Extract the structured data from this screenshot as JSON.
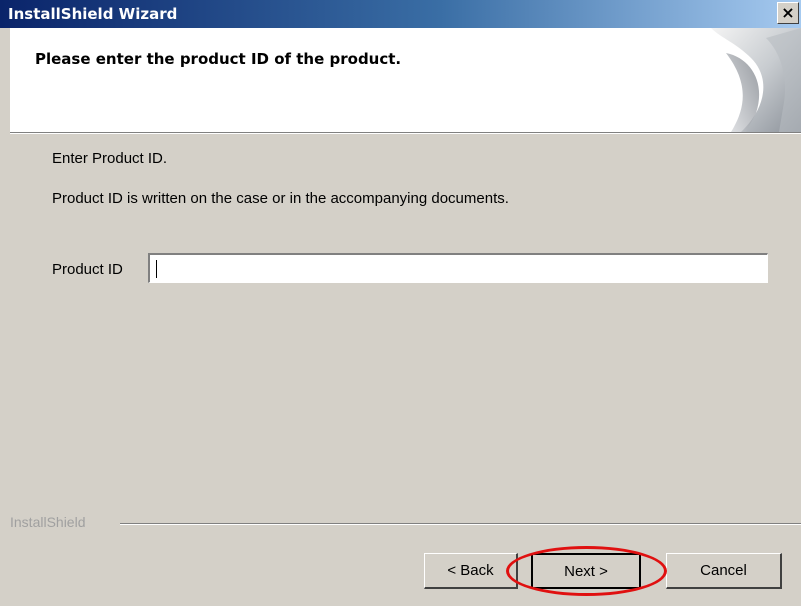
{
  "window": {
    "title": "InstallShield Wizard",
    "close_glyph": "×"
  },
  "header": {
    "title": "Please enter the product ID of the product."
  },
  "body": {
    "instruction": "Enter Product ID.",
    "description": "Product ID is written on the case or in the accompanying documents.",
    "field_label": "Product ID",
    "field_value": ""
  },
  "footer": {
    "brand": "InstallShield",
    "back_label": "< Back",
    "next_label": "Next >",
    "cancel_label": "Cancel"
  },
  "annotation": {
    "color": "#e01010"
  },
  "colors": {
    "dialog_bg": "#d4d0c8",
    "title_start": "#0a246a",
    "title_end": "#a6caf0"
  }
}
